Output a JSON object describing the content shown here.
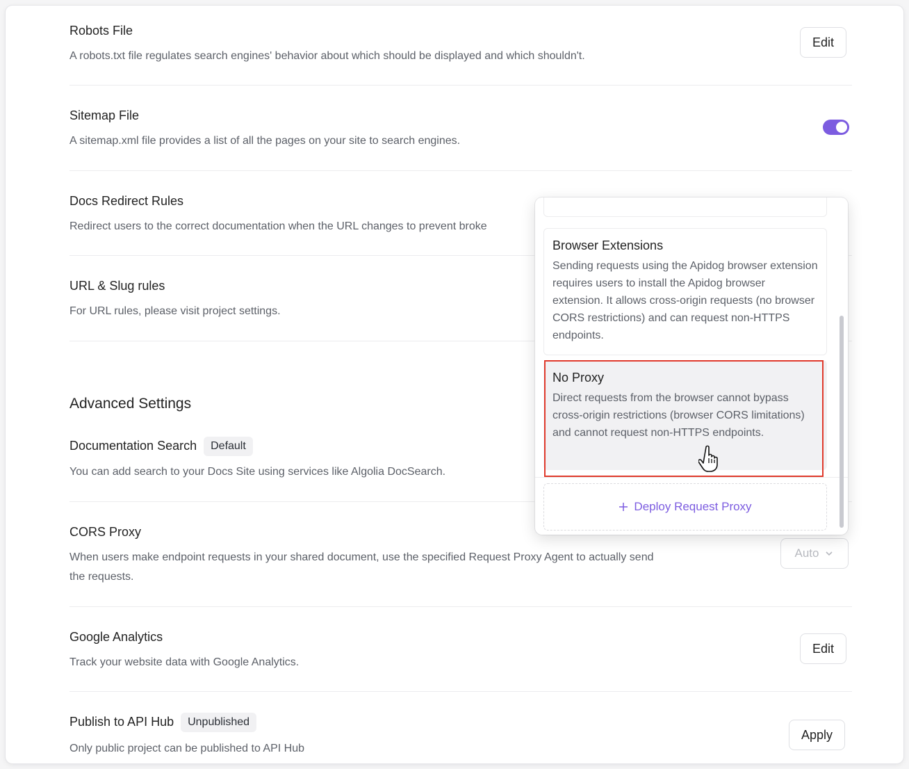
{
  "robots": {
    "title": "Robots File",
    "description": "A robots.txt file regulates search engines' behavior about which should be displayed and which shouldn't.",
    "button": "Edit"
  },
  "sitemap": {
    "title": "Sitemap File",
    "description": "A sitemap.xml file provides a list of all the pages on your site to search engines.",
    "toggle_on": true
  },
  "redirect": {
    "title": "Docs Redirect Rules",
    "description": "Redirect users to the correct documentation when the URL changes to prevent broke"
  },
  "url_slug": {
    "title": "URL & Slug rules",
    "description": "For URL rules, please visit project settings."
  },
  "advanced": {
    "heading": "Advanced Settings"
  },
  "doc_search": {
    "title": "Documentation Search",
    "badge": "Default",
    "description": "You can add search to your Docs Site using services like Algolia DocSearch."
  },
  "cors": {
    "title": "CORS Proxy",
    "description_line1": "When users make endpoint requests in your shared document, use the specified Request Proxy Agent to actually send",
    "description_line2": "the requests.",
    "select_value": "Auto"
  },
  "analytics": {
    "title": "Google Analytics",
    "description": "Track your website data with Google Analytics.",
    "button": "Edit"
  },
  "api_hub": {
    "title": "Publish to API Hub",
    "badge": "Unpublished",
    "description": "Only public project can be published to API Hub",
    "button": "Apply"
  },
  "dropdown": {
    "options": [
      {
        "title": "Browser Extensions",
        "description": "Sending requests using the Apidog browser extension requires users to install the Apidog browser extension. It allows cross-origin requests (no browser CORS restrictions) and can request non-HTTPS endpoints."
      },
      {
        "title": "No Proxy",
        "description": "Direct requests from the browser cannot bypass cross-origin restrictions (browser CORS limitations) and cannot request non-HTTPS endpoints."
      }
    ],
    "deploy_label": "Deploy Request Proxy",
    "accent": "#7c5ce0",
    "highlight_color": "#e0392b"
  }
}
